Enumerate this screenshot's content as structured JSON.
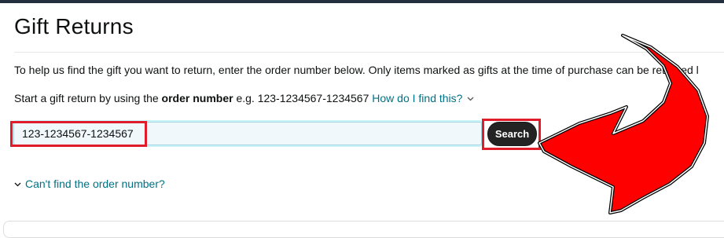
{
  "page": {
    "title": "Gift Returns",
    "intro_text": "To help us find the gift you want to return, enter the order number below. Only items marked as gifts at the time of purchase can be returned l",
    "start_prefix": "Start a gift return by using the ",
    "start_bold": "order number",
    "start_suffix": " e.g. 123-1234567-1234567 ",
    "how_link": "How do I find this?",
    "search": {
      "value": "123-1234567-1234567",
      "button_label": "Search"
    },
    "cant_find_link": "Can't find the order number?"
  },
  "colors": {
    "link": "#007185",
    "highlight": "#e01b2a",
    "arrow_fill": "#ff0000",
    "button_bg": "#232323",
    "top_bar": "#232f3e"
  },
  "icons": [
    "chevron-down-icon",
    "chevron-down-icon",
    "red-arrow-annotation"
  ]
}
